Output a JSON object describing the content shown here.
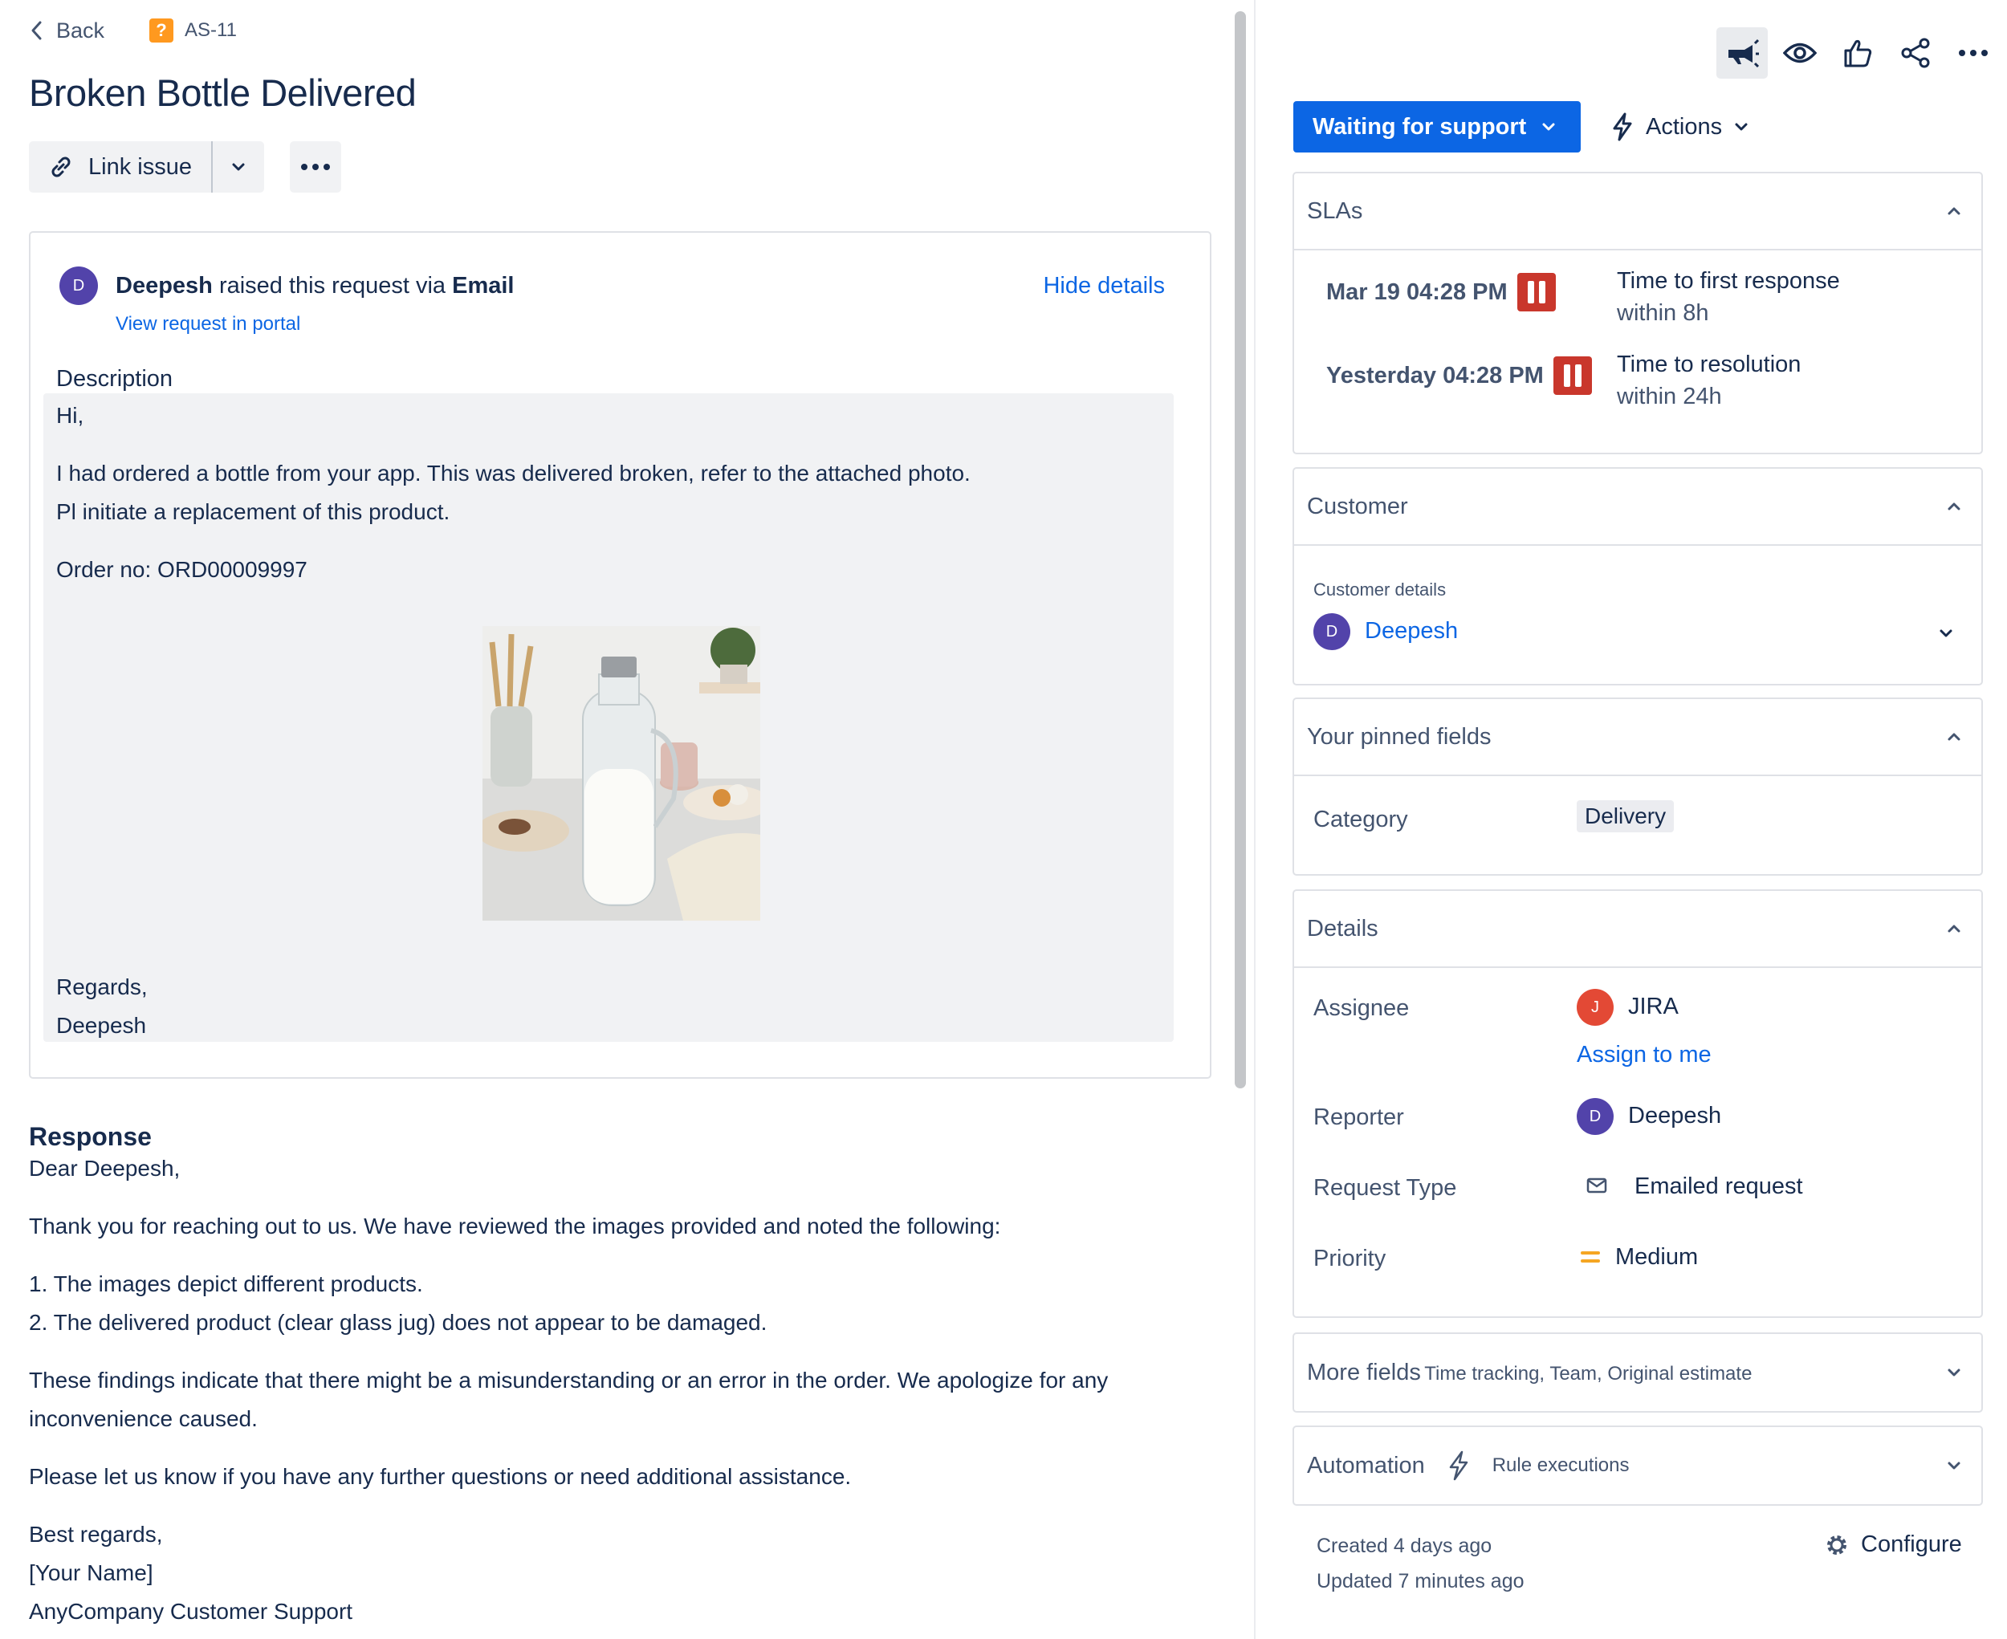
{
  "nav": {
    "back_label": "Back",
    "issue_key": "AS-11"
  },
  "issue": {
    "title": "Broken Bottle Delivered"
  },
  "toolbar": {
    "link_issue_label": "Link issue"
  },
  "request": {
    "avatar_initial": "D",
    "reporter": "Deepesh",
    "raised_text": "raised this request via",
    "channel": "Email",
    "view_portal": "View request in portal",
    "hide_details": "Hide details",
    "description_label": "Description",
    "description_lines": {
      "l1": "Hi,",
      "l2": "I had ordered a bottle from your app. This was delivered broken, refer to the attached photo.",
      "l3": "Pl initiate a replacement of this product.",
      "l4": "Order no: ORD00009997",
      "l5": "Regards,",
      "l6": "Deepesh"
    }
  },
  "response": {
    "heading": "Response",
    "lines": {
      "l1": "Dear Deepesh,",
      "l2": "Thank you for reaching out to us. We have reviewed the images provided and noted the following:",
      "l3": "1. The images depict different products.",
      "l4": "2. The delivered product (clear glass jug) does not appear to be damaged.",
      "l5": "These findings indicate that there might be a misunderstanding or an error in the order. We apologize for any",
      "l6": "inconvenience caused.",
      "l7": "Please let us know if you have any further questions or need additional assistance.",
      "l8": "Best regards,",
      "l9": "[Your Name]",
      "l10": "AnyCompany Customer Support"
    }
  },
  "sidebar": {
    "status_label": "Waiting for support",
    "actions_label": "Actions",
    "slas": {
      "title": "SLAs",
      "items": [
        {
          "time": "Mar 19 04:28 PM",
          "goal": "Time to first response",
          "within": "within 8h"
        },
        {
          "time": "Yesterday 04:28 PM",
          "goal": "Time to resolution",
          "within": "within 24h"
        }
      ]
    },
    "customer": {
      "title": "Customer",
      "details_label": "Customer details",
      "avatar_initial": "D",
      "name": "Deepesh"
    },
    "pinned": {
      "title": "Your pinned fields",
      "category_label": "Category",
      "category_value": "Delivery"
    },
    "details": {
      "title": "Details",
      "assignee_label": "Assignee",
      "assignee_initial": "J",
      "assignee_name": "JIRA",
      "assign_to_me": "Assign to me",
      "reporter_label": "Reporter",
      "reporter_initial": "D",
      "reporter_name": "Deepesh",
      "request_type_label": "Request Type",
      "request_type_value": "Emailed request",
      "priority_label": "Priority",
      "priority_value": "Medium"
    },
    "more_fields": {
      "title": "More fields",
      "hint": "Time tracking, Team, Original estimate"
    },
    "automation": {
      "title": "Automation",
      "hint": "Rule executions"
    },
    "created": "Created 4 days ago",
    "updated": "Updated 7 minutes ago",
    "configure": "Configure"
  },
  "colors": {
    "brand_blue": "#0c66e4",
    "sla_paused": "#c9372c",
    "avatar_purple": "#5243aa",
    "avatar_orange": "#e34935",
    "priority_medium": "#f5a623"
  }
}
